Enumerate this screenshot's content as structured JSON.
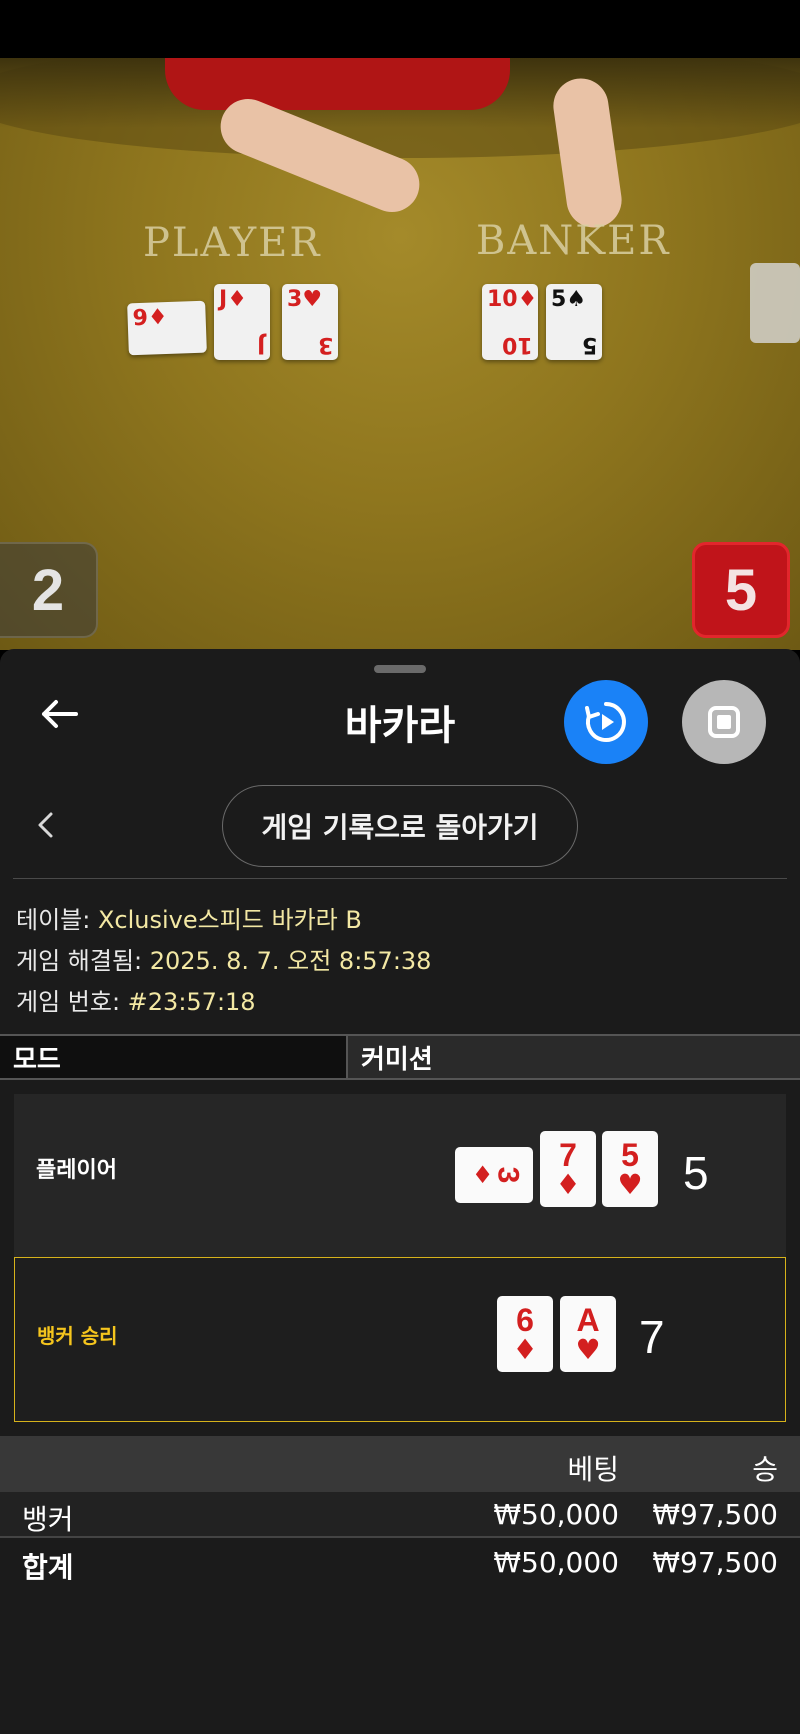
{
  "video": {
    "table_labels": {
      "player": "PLAYER",
      "banker": "BANKER"
    },
    "player_cards": [
      {
        "rank": "9",
        "suit": "♦"
      },
      {
        "rank": "J",
        "suit": "♦"
      },
      {
        "rank": "3",
        "suit": "♥"
      }
    ],
    "banker_cards": [
      {
        "rank": "10",
        "suit": "♦"
      },
      {
        "rank": "5",
        "suit": "♠"
      }
    ],
    "player_score": "2",
    "banker_score": "5"
  },
  "sheet": {
    "title": "바카라",
    "history_button": "게임 기록으로 돌아가기",
    "info": {
      "table_label": "테이블: ",
      "table_value": "Xclusive스피드 바카라 B",
      "resolved_label": "게임 해결됨: ",
      "resolved_value": "2025. 8. 7. 오전 8:57:38",
      "number_label": "게임 번호: ",
      "number_value": "#23:57:18"
    },
    "mode": {
      "label": "모드",
      "value": "커미션"
    },
    "player_hand": {
      "label": "플레이어",
      "cards": [
        {
          "rank": "3",
          "suit": "♦"
        },
        {
          "rank": "7",
          "suit": "♦"
        },
        {
          "rank": "5",
          "suit": "♥"
        }
      ],
      "total": "5"
    },
    "banker_hand": {
      "label": "뱅커 승리",
      "cards": [
        {
          "rank": "6",
          "suit": "♦"
        },
        {
          "rank": "A",
          "suit": "♥"
        }
      ],
      "total": "7"
    },
    "bets": {
      "header": {
        "bet": "베팅",
        "win": "승"
      },
      "rows": [
        {
          "name": "뱅커",
          "bet": "₩50,000",
          "win": "₩97,500"
        },
        {
          "name": "합계",
          "bet": "₩50,000",
          "win": "₩97,500"
        }
      ]
    }
  },
  "colors": {
    "accent_blue": "#1a82f7",
    "winner_gold": "#f5c51d",
    "info_value": "#f3e8a4",
    "card_red": "#d31f1f"
  }
}
